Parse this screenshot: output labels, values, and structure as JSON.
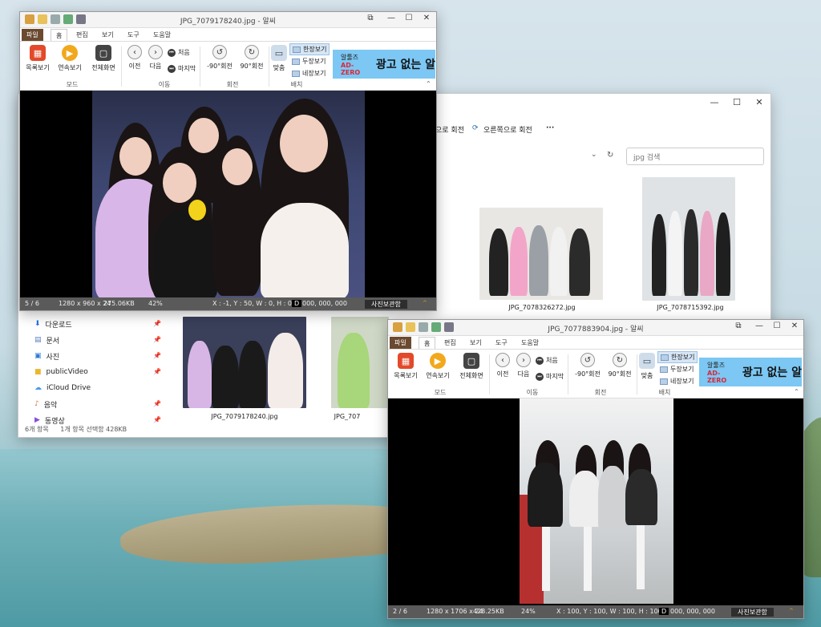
{
  "explorer": {
    "cmd_rotate_left": "왼쪽으로 회전",
    "cmd_rotate_left_visible": "으로 회전",
    "cmd_rotate_right": "오른쪽으로 회전",
    "cmd_more": "···",
    "search_placeholder": "jpg 검색",
    "nav_items": [
      {
        "label": "다운로드",
        "icon": "download-icon"
      },
      {
        "label": "문서",
        "icon": "document-icon"
      },
      {
        "label": "사진",
        "icon": "pictures-icon"
      },
      {
        "label": "publicVideo",
        "icon": "folder-icon"
      },
      {
        "label": "iCloud Drive",
        "icon": "cloud-icon"
      },
      {
        "label": "음악",
        "icon": "music-icon"
      },
      {
        "label": "동영상",
        "icon": "video-icon"
      }
    ],
    "files": [
      {
        "name": "JPG_7078326272.jpg"
      },
      {
        "name": "JPG_7078715392.jpg"
      },
      {
        "name": "JPG_7079178240.jpg"
      },
      {
        "name": "JPG_707"
      }
    ],
    "status_count": "6개 항목",
    "status_selection": "1개 항목 선택함 428KB"
  },
  "viewer1": {
    "title": "JPG_7079178240.jpg - 알씨",
    "tabs": [
      "파일",
      "홈",
      "편집",
      "보기",
      "도구",
      "도움말"
    ],
    "buttons": {
      "thumbnails": "목록보기",
      "slideshow": "연속보기",
      "fullscreen": "전체화면",
      "prev": "이전",
      "next": "다음",
      "first": "처음",
      "last": "마지막",
      "rotate_left": "-90°회전",
      "rotate_right": "90°회전",
      "fit": "맞춤",
      "single": "한장보기",
      "double": "두장보기",
      "quad": "네장보기"
    },
    "groups": {
      "mode": "모드",
      "move": "이동",
      "rotate": "회전",
      "layout": "배치"
    },
    "ad": {
      "brand_prefix": "알툴즈",
      "brand_name": "AD-ZERO",
      "slogan": "광고 없는 알"
    },
    "status": {
      "index": "5 / 6",
      "dims": "1280 x 960 x 24",
      "size": "275.06KB",
      "zoom": "42%",
      "coords": "X : -1, Y : 50, W : 0, H : 0",
      "d": "D",
      "color": "000, 000, 000",
      "album": "사진보관함",
      "chevron": "^"
    }
  },
  "viewer2": {
    "title": "JPG_7077883904.jpg - 알씨",
    "tabs": [
      "파일",
      "홈",
      "편집",
      "보기",
      "도구",
      "도움말"
    ],
    "buttons": {
      "thumbnails": "목록보기",
      "slideshow": "연속보기",
      "fullscreen": "전체화면",
      "prev": "이전",
      "next": "다음",
      "first": "처음",
      "last": "마지막",
      "rotate_left": "-90°회전",
      "rotate_right": "90°회전",
      "fit": "맞춤",
      "single": "한장보기",
      "double": "두장보기",
      "quad": "네장보기"
    },
    "groups": {
      "mode": "모드",
      "move": "이동",
      "rotate": "회전",
      "layout": "배치"
    },
    "ad": {
      "brand_prefix": "알툴즈",
      "brand_name": "AD-ZERO",
      "slogan": "광고 없는 알"
    },
    "status": {
      "index": "2 / 6",
      "dims": "1280 x 1706 x 24",
      "size": "428.25KB",
      "zoom": "24%",
      "coords": "X : 100, Y : 100, W : 100, H : 100",
      "d": "D",
      "color": "000, 000, 000",
      "album": "사진보관함",
      "chevron": "^"
    }
  },
  "colors": {
    "file_tab": "#6b4a30",
    "ad_bg": "#7cc7f3",
    "status_bg": "#5a5a5a",
    "selected": "#d6e6f5"
  }
}
